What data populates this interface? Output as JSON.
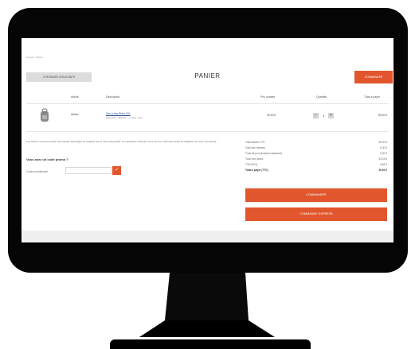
{
  "colors": {
    "accent": "#e1562c",
    "bezel": "#050505",
    "link": "#2c4d8a"
  },
  "icons": {
    "product": "backpack-icon",
    "promo_submit": "check-icon"
  },
  "page": {
    "breadcrumb": "Accueil › Panier",
    "title": "PANIER",
    "continue_button": "CONTINUER VOS ACHATS",
    "top_order_button": "COMMANDER"
  },
  "table": {
    "headers": [
      "Article",
      "Description",
      "Prix unitaire",
      "Quantité",
      "Total à payer"
    ],
    "row": {
      "article": "Article",
      "description": "Sac à dos Rider 20L",
      "description_sub": "Référence : SDR-20 — Coloris : Noir",
      "unit_price": "39,90 €",
      "quantity": "1",
      "qty_minus": "−",
      "qty_plus": "+",
      "total": "39,90 €"
    }
  },
  "note": "Les Clients ne peuvent pas commander davantage de produits que le stock disponible. Les quantités restantes vous seront confirmées avant la validation de votre commande.",
  "promo": {
    "title": "Vous avez un code promo ?",
    "label": "Code promotionnel",
    "placeholder": "",
    "submit": "✓"
  },
  "summary": [
    {
      "label": "Total articles TTC",
      "value": "39,90 €"
    },
    {
      "label": "Total des remises",
      "value": "0,00 €"
    },
    {
      "label": "Frais de port (livraison standard)",
      "value": "0,00 €"
    },
    {
      "label": "Total hors taxes",
      "value": "33,25 €"
    },
    {
      "label": "TVA (20%)",
      "value": "6,65 €"
    }
  ],
  "summary_total": {
    "label": "Total à payer (TTC)",
    "value": "39,90 €"
  },
  "buttons": {
    "order": "COMMANDER",
    "express": "COMMANDE EXPRESS"
  }
}
